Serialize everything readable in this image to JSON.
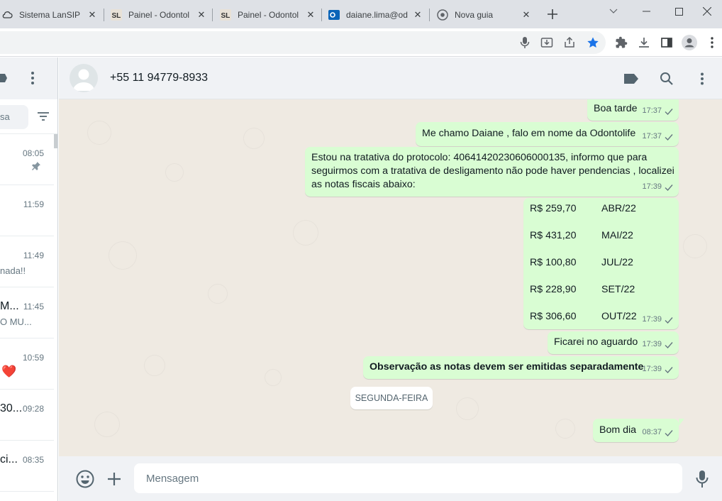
{
  "browser": {
    "tabs": [
      {
        "title": "Sistema LanSIP",
        "icon": "cloud-icon"
      },
      {
        "title": "Painel - Odontol",
        "icon": "sl-logo-icon"
      },
      {
        "title": "Painel - Odontol",
        "icon": "sl-logo-icon"
      },
      {
        "title": "daiane.lima@od",
        "icon": "outlook-icon"
      },
      {
        "title": "Nova guia",
        "icon": "chrome-icon"
      }
    ],
    "bookmark_star_color": "#1a73e8"
  },
  "sidebar": {
    "search_placeholder": "sa",
    "chats": [
      {
        "name": "",
        "preview": "",
        "time": "08:05",
        "pinned": true
      },
      {
        "name": "",
        "preview": "",
        "time": "11:59"
      },
      {
        "name": "",
        "preview": "nada!!",
        "time": "11:49"
      },
      {
        "name": "M...",
        "preview": "O MU...",
        "time": "11:45"
      },
      {
        "name": "",
        "preview": "❤️",
        "time": "10:59"
      },
      {
        "name": "30...",
        "preview": "",
        "time": "09:28"
      },
      {
        "name": "ci...",
        "preview": "",
        "time": "08:35"
      }
    ]
  },
  "conversation": {
    "contact": "+55 11 94779-8933",
    "messages": {
      "m1": {
        "text": "Boa tarde",
        "time": "17:37"
      },
      "m2": {
        "text": "Me chamo Daiane , falo em nome da Odontolife",
        "time": "17:37"
      },
      "m3": {
        "lines": [
          "Estou na tratativa do protocolo: 40641420230606000135, informo que para",
          "seguirmos com a tratativa de desligamento não pode haver pendencias , localizei",
          "as notas fiscais abaixo:"
        ],
        "time": "17:39"
      },
      "m4": {
        "rows": [
          {
            "amount": "R$ 259,70",
            "month": "ABR/22"
          },
          {
            "amount": "R$ 431,20",
            "month": "MAI/22"
          },
          {
            "amount": "R$ 100,80",
            "month": "JUL/22"
          },
          {
            "amount": "R$ 228,90",
            "month": "SET/22"
          },
          {
            "amount": "R$ 306,60",
            "month": "OUT/22"
          }
        ],
        "time": "17:39"
      },
      "m5": {
        "text": "Ficarei no aguardo",
        "time": "17:39"
      },
      "m6": {
        "text": "Observação as notas devem ser emitidas separadamente",
        "time": "17:39"
      },
      "day_divider": "SEGUNDA-FEIRA",
      "m7": {
        "text": "Bom dia",
        "time": "08:37"
      }
    }
  },
  "composer": {
    "placeholder": "Mensagem"
  },
  "colors": {
    "outgoing_bubble": "#d9fdd3",
    "chat_background": "#efeae2",
    "header": "#f0f2f5"
  }
}
